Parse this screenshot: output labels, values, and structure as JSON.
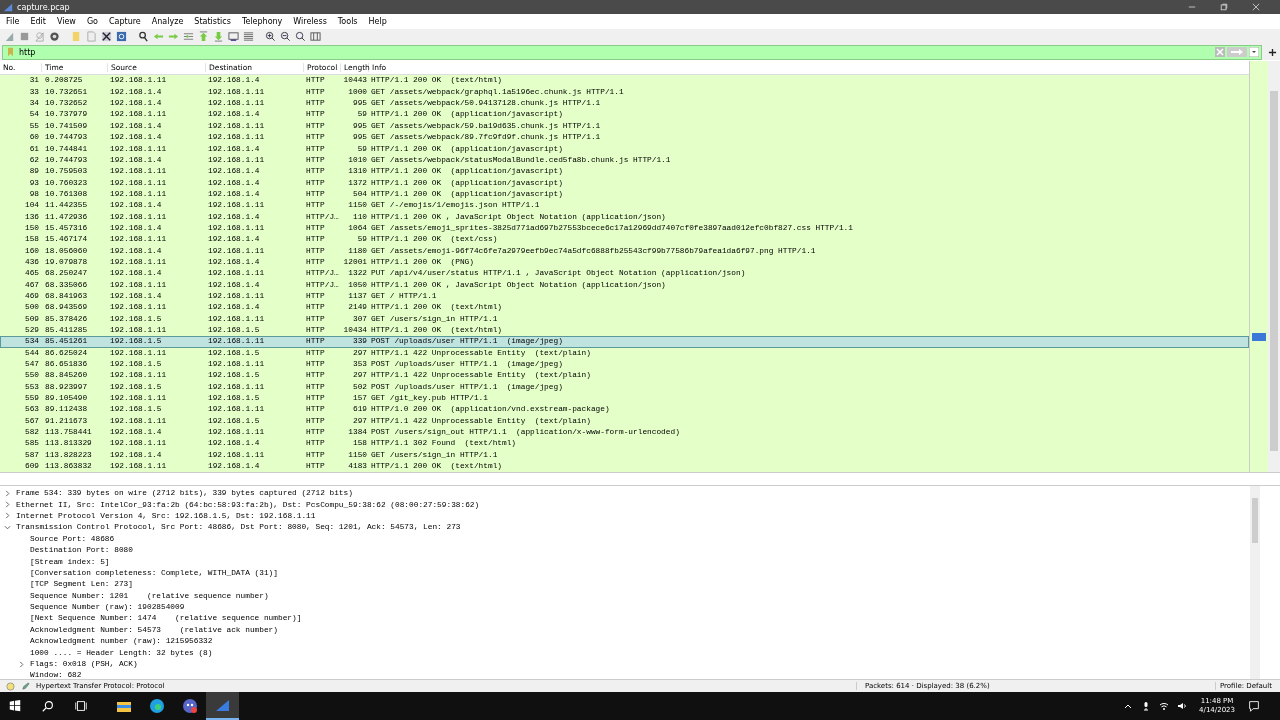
{
  "window": {
    "title": "capture.pcap"
  },
  "menu": [
    "File",
    "Edit",
    "View",
    "Go",
    "Capture",
    "Analyze",
    "Statistics",
    "Telephony",
    "Wireless",
    "Tools",
    "Help"
  ],
  "filter": {
    "value": "http"
  },
  "columns": [
    "No.",
    "Time",
    "Source",
    "Destination",
    "Protocol",
    "Length",
    "Info"
  ],
  "packets": [
    {
      "no": "31",
      "time": "0.208725",
      "source": "192.168.1.11",
      "destination": "192.168.1.4",
      "protocol": "HTTP",
      "length": "10443",
      "info": "HTTP/1.1 200 OK  (text/html)",
      "selected": false
    },
    {
      "no": "33",
      "time": "10.732651",
      "source": "192.168.1.4",
      "destination": "192.168.1.11",
      "protocol": "HTTP",
      "length": "1000",
      "info": "GET /assets/webpack/graphql.1a5196ec.chunk.js HTTP/1.1",
      "selected": false
    },
    {
      "no": "34",
      "time": "10.732652",
      "source": "192.168.1.4",
      "destination": "192.168.1.11",
      "protocol": "HTTP",
      "length": "995",
      "info": "GET /assets/webpack/50.94137128.chunk.js HTTP/1.1",
      "selected": false
    },
    {
      "no": "54",
      "time": "10.737979",
      "source": "192.168.1.11",
      "destination": "192.168.1.4",
      "protocol": "HTTP",
      "length": "59",
      "info": "HTTP/1.1 200 OK  (application/javascript)",
      "selected": false
    },
    {
      "no": "55",
      "time": "10.741509",
      "source": "192.168.1.4",
      "destination": "192.168.1.11",
      "protocol": "HTTP",
      "length": "995",
      "info": "GET /assets/webpack/59.ba19d635.chunk.js HTTP/1.1",
      "selected": false
    },
    {
      "no": "60",
      "time": "10.744793",
      "source": "192.168.1.4",
      "destination": "192.168.1.11",
      "protocol": "HTTP",
      "length": "995",
      "info": "GET /assets/webpack/89.7fc9fd9f.chunk.js HTTP/1.1",
      "selected": false
    },
    {
      "no": "61",
      "time": "10.744841",
      "source": "192.168.1.11",
      "destination": "192.168.1.4",
      "protocol": "HTTP",
      "length": "59",
      "info": "HTTP/1.1 200 OK  (application/javascript)",
      "selected": false
    },
    {
      "no": "62",
      "time": "10.744793",
      "source": "192.168.1.4",
      "destination": "192.168.1.11",
      "protocol": "HTTP",
      "length": "1010",
      "info": "GET /assets/webpack/statusModalBundle.ced5fa8b.chunk.js HTTP/1.1",
      "selected": false
    },
    {
      "no": "89",
      "time": "10.759503",
      "source": "192.168.1.11",
      "destination": "192.168.1.4",
      "protocol": "HTTP",
      "length": "1310",
      "info": "HTTP/1.1 200 OK  (application/javascript)",
      "selected": false
    },
    {
      "no": "93",
      "time": "10.760323",
      "source": "192.168.1.11",
      "destination": "192.168.1.4",
      "protocol": "HTTP",
      "length": "1372",
      "info": "HTTP/1.1 200 OK  (application/javascript)",
      "selected": false
    },
    {
      "no": "98",
      "time": "10.761308",
      "source": "192.168.1.11",
      "destination": "192.168.1.4",
      "protocol": "HTTP",
      "length": "504",
      "info": "HTTP/1.1 200 OK  (application/javascript)",
      "selected": false
    },
    {
      "no": "104",
      "time": "11.442355",
      "source": "192.168.1.4",
      "destination": "192.168.1.11",
      "protocol": "HTTP",
      "length": "1150",
      "info": "GET /-/emojis/1/emojis.json HTTP/1.1",
      "selected": false
    },
    {
      "no": "136",
      "time": "11.472936",
      "source": "192.168.1.11",
      "destination": "192.168.1.4",
      "protocol": "HTTP/J…",
      "length": "110",
      "info": "HTTP/1.1 200 OK , JavaScript Object Notation (application/json)",
      "selected": false
    },
    {
      "no": "150",
      "time": "15.457316",
      "source": "192.168.1.4",
      "destination": "192.168.1.11",
      "protocol": "HTTP",
      "length": "1064",
      "info": "GET /assets/emoji_sprites-3825d771ad697b27553bcece6c17a12969dd7407cf0fe3897aad012efc0bf827.css HTTP/1.1",
      "selected": false
    },
    {
      "no": "158",
      "time": "15.467174",
      "source": "192.168.1.11",
      "destination": "192.168.1.4",
      "protocol": "HTTP",
      "length": "59",
      "info": "HTTP/1.1 200 OK  (text/css)",
      "selected": false
    },
    {
      "no": "160",
      "time": "18.056060",
      "source": "192.168.1.4",
      "destination": "192.168.1.11",
      "protocol": "HTTP",
      "length": "1180",
      "info": "GET /assets/emoji-96f74c6fe7a2979eefb9ec74a5dfc6888fb25543cf99b77586b79afea1da6f97.png HTTP/1.1",
      "selected": false
    },
    {
      "no": "436",
      "time": "19.079878",
      "source": "192.168.1.11",
      "destination": "192.168.1.4",
      "protocol": "HTTP",
      "length": "12001",
      "info": "HTTP/1.1 200 OK  (PNG)",
      "selected": false
    },
    {
      "no": "465",
      "time": "68.250247",
      "source": "192.168.1.4",
      "destination": "192.168.1.11",
      "protocol": "HTTP/J…",
      "length": "1322",
      "info": "PUT /api/v4/user/status HTTP/1.1 , JavaScript Object Notation (application/json)",
      "selected": false
    },
    {
      "no": "467",
      "time": "68.335066",
      "source": "192.168.1.11",
      "destination": "192.168.1.4",
      "protocol": "HTTP/J…",
      "length": "1050",
      "info": "HTTP/1.1 200 OK , JavaScript Object Notation (application/json)",
      "selected": false
    },
    {
      "no": "469",
      "time": "68.841963",
      "source": "192.168.1.4",
      "destination": "192.168.1.11",
      "protocol": "HTTP",
      "length": "1137",
      "info": "GET / HTTP/1.1",
      "selected": false
    },
    {
      "no": "500",
      "time": "68.943569",
      "source": "192.168.1.11",
      "destination": "192.168.1.4",
      "protocol": "HTTP",
      "length": "2149",
      "info": "HTTP/1.1 200 OK  (text/html)",
      "selected": false
    },
    {
      "no": "509",
      "time": "85.378426",
      "source": "192.168.1.5",
      "destination": "192.168.1.11",
      "protocol": "HTTP",
      "length": "307",
      "info": "GET /users/sign_in HTTP/1.1",
      "selected": false
    },
    {
      "no": "529",
      "time": "85.411285",
      "source": "192.168.1.11",
      "destination": "192.168.1.5",
      "protocol": "HTTP",
      "length": "10434",
      "info": "HTTP/1.1 200 OK  (text/html)",
      "selected": false
    },
    {
      "no": "534",
      "time": "85.451261",
      "source": "192.168.1.5",
      "destination": "192.168.1.11",
      "protocol": "HTTP",
      "length": "339",
      "info": "POST /uploads/user HTTP/1.1  (image/jpeg)",
      "selected": true
    },
    {
      "no": "544",
      "time": "86.625024",
      "source": "192.168.1.11",
      "destination": "192.168.1.5",
      "protocol": "HTTP",
      "length": "297",
      "info": "HTTP/1.1 422 Unprocessable Entity  (text/plain)",
      "selected": false
    },
    {
      "no": "547",
      "time": "86.651836",
      "source": "192.168.1.5",
      "destination": "192.168.1.11",
      "protocol": "HTTP",
      "length": "353",
      "info": "POST /uploads/user HTTP/1.1  (image/jpeg)",
      "selected": false
    },
    {
      "no": "550",
      "time": "88.845260",
      "source": "192.168.1.11",
      "destination": "192.168.1.5",
      "protocol": "HTTP",
      "length": "297",
      "info": "HTTP/1.1 422 Unprocessable Entity  (text/plain)",
      "selected": false
    },
    {
      "no": "553",
      "time": "88.923997",
      "source": "192.168.1.5",
      "destination": "192.168.1.11",
      "protocol": "HTTP",
      "length": "502",
      "info": "POST /uploads/user HTTP/1.1  (image/jpeg)",
      "selected": false
    },
    {
      "no": "559",
      "time": "89.105490",
      "source": "192.168.1.11",
      "destination": "192.168.1.5",
      "protocol": "HTTP",
      "length": "157",
      "info": "GET /git_key.pub HTTP/1.1",
      "selected": false
    },
    {
      "no": "563",
      "time": "89.112438",
      "source": "192.168.1.5",
      "destination": "192.168.1.11",
      "protocol": "HTTP",
      "length": "619",
      "info": "HTTP/1.0 200 OK  (application/vnd.exstream-package)",
      "selected": false
    },
    {
      "no": "567",
      "time": "91.211673",
      "source": "192.168.1.11",
      "destination": "192.168.1.5",
      "protocol": "HTTP",
      "length": "297",
      "info": "HTTP/1.1 422 Unprocessable Entity  (text/plain)",
      "selected": false
    },
    {
      "no": "582",
      "time": "113.758441",
      "source": "192.168.1.4",
      "destination": "192.168.1.11",
      "protocol": "HTTP",
      "length": "1384",
      "info": "POST /users/sign_out HTTP/1.1  (application/x-www-form-urlencoded)",
      "selected": false
    },
    {
      "no": "585",
      "time": "113.813329",
      "source": "192.168.1.11",
      "destination": "192.168.1.4",
      "protocol": "HTTP",
      "length": "158",
      "info": "HTTP/1.1 302 Found  (text/html)",
      "selected": false
    },
    {
      "no": "587",
      "time": "113.828223",
      "source": "192.168.1.4",
      "destination": "192.168.1.11",
      "protocol": "HTTP",
      "length": "1150",
      "info": "GET /users/sign_in HTTP/1.1",
      "selected": false
    },
    {
      "no": "609",
      "time": "113.863832",
      "source": "192.168.1.11",
      "destination": "192.168.1.4",
      "protocol": "HTTP",
      "length": "4183",
      "info": "HTTP/1.1 200 OK  (text/html)",
      "selected": false
    }
  ],
  "details": [
    {
      "text": "Frame 534: 339 bytes on wire (2712 bits), 339 bytes captured (2712 bits)",
      "expanded": false
    },
    {
      "text": "Ethernet II, Src: IntelCor_93:fa:2b (64:bc:58:93:fa:2b), Dst: PcsCompu_59:38:62 (08:00:27:59:38:62)",
      "expanded": false
    },
    {
      "text": "Internet Protocol Version 4, Src: 192.168.1.5, Dst: 192.168.1.11",
      "expanded": false
    },
    {
      "text": "Transmission Control Protocol, Src Port: 48686, Dst Port: 8080, Seq: 1201, Ack: 54573, Len: 273",
      "expanded": true,
      "children": [
        {
          "text": "Source Port: 48686"
        },
        {
          "text": "Destination Port: 8080"
        },
        {
          "text": "[Stream index: 5]"
        },
        {
          "text": "[Conversation completeness: Complete, WITH_DATA (31)]"
        },
        {
          "text": "[TCP Segment Len: 273]"
        },
        {
          "text": "Sequence Number: 1201    (relative sequence number)"
        },
        {
          "text": "Sequence Number (raw): 1902854009"
        },
        {
          "text": "[Next Sequence Number: 1474    (relative sequence number)]"
        },
        {
          "text": "Acknowledgment Number: 54573    (relative ack number)"
        },
        {
          "text": "Acknowledgment number (raw): 1215956332"
        },
        {
          "text": "1000 .... = Header Length: 32 bytes (8)"
        },
        {
          "text": "Flags: 0x018 (PSH, ACK)",
          "expanded": false
        },
        {
          "text": "Window: 682"
        }
      ]
    }
  ],
  "status_bar": {
    "message": "Hypertext Transfer Protocol: Protocol",
    "packets": "Packets: 614 · Displayed: 38 (6.2%)",
    "profile": "Profile: Default"
  },
  "taskbar": {
    "apps": [
      {
        "kind": "explorer",
        "selected": false
      },
      {
        "kind": "edge",
        "selected": false
      },
      {
        "kind": "chat",
        "selected": false
      },
      {
        "kind": "wireshark",
        "selected": true
      }
    ],
    "time": "11:48 PM",
    "date": "4/14/2023"
  }
}
